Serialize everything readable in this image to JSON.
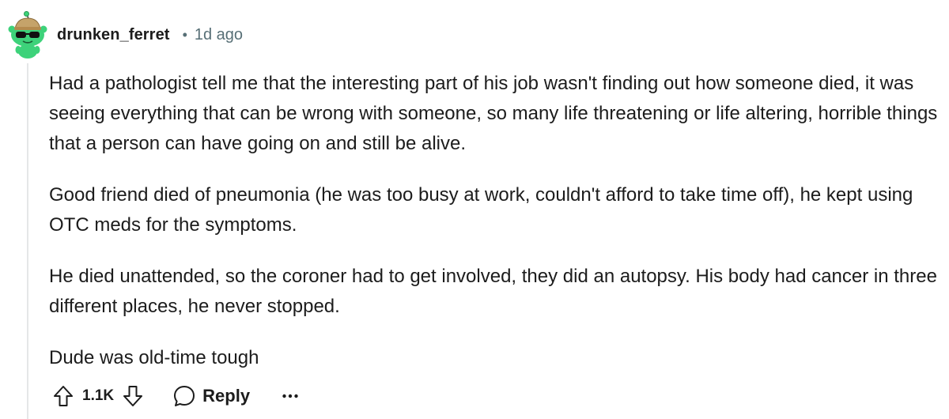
{
  "comment": {
    "author": "drunken_ferret",
    "separator": "•",
    "timestamp": "1d ago",
    "avatar_icon": "snoo-avatar-icon",
    "paragraphs": [
      "Had a pathologist tell me that the interesting part of his job wasn't finding out how someone died, it was seeing everything that can be wrong with someone, so many life threatening or life altering, horrible things that a person can have going on and still be alive.",
      "Good friend died of pneumonia (he was too busy at work, couldn't afford to take time off), he kept using OTC meds for the symptoms.",
      "He died unattended, so the coroner had to get involved, they did an autopsy. His body had cancer in three different places, he never stopped.",
      "Dude was old-time tough"
    ],
    "actions": {
      "upvote_icon": "arrow-up-icon",
      "score": "1.1K",
      "downvote_icon": "arrow-down-icon",
      "reply_icon": "speech-bubble-icon",
      "reply_label": "Reply",
      "more_icon": "ellipsis-icon"
    }
  },
  "colors": {
    "text": "#1c1c1c",
    "meta": "#576f76",
    "thread_line": "#e5e7e8",
    "avatar_green": "#3dd27a"
  }
}
